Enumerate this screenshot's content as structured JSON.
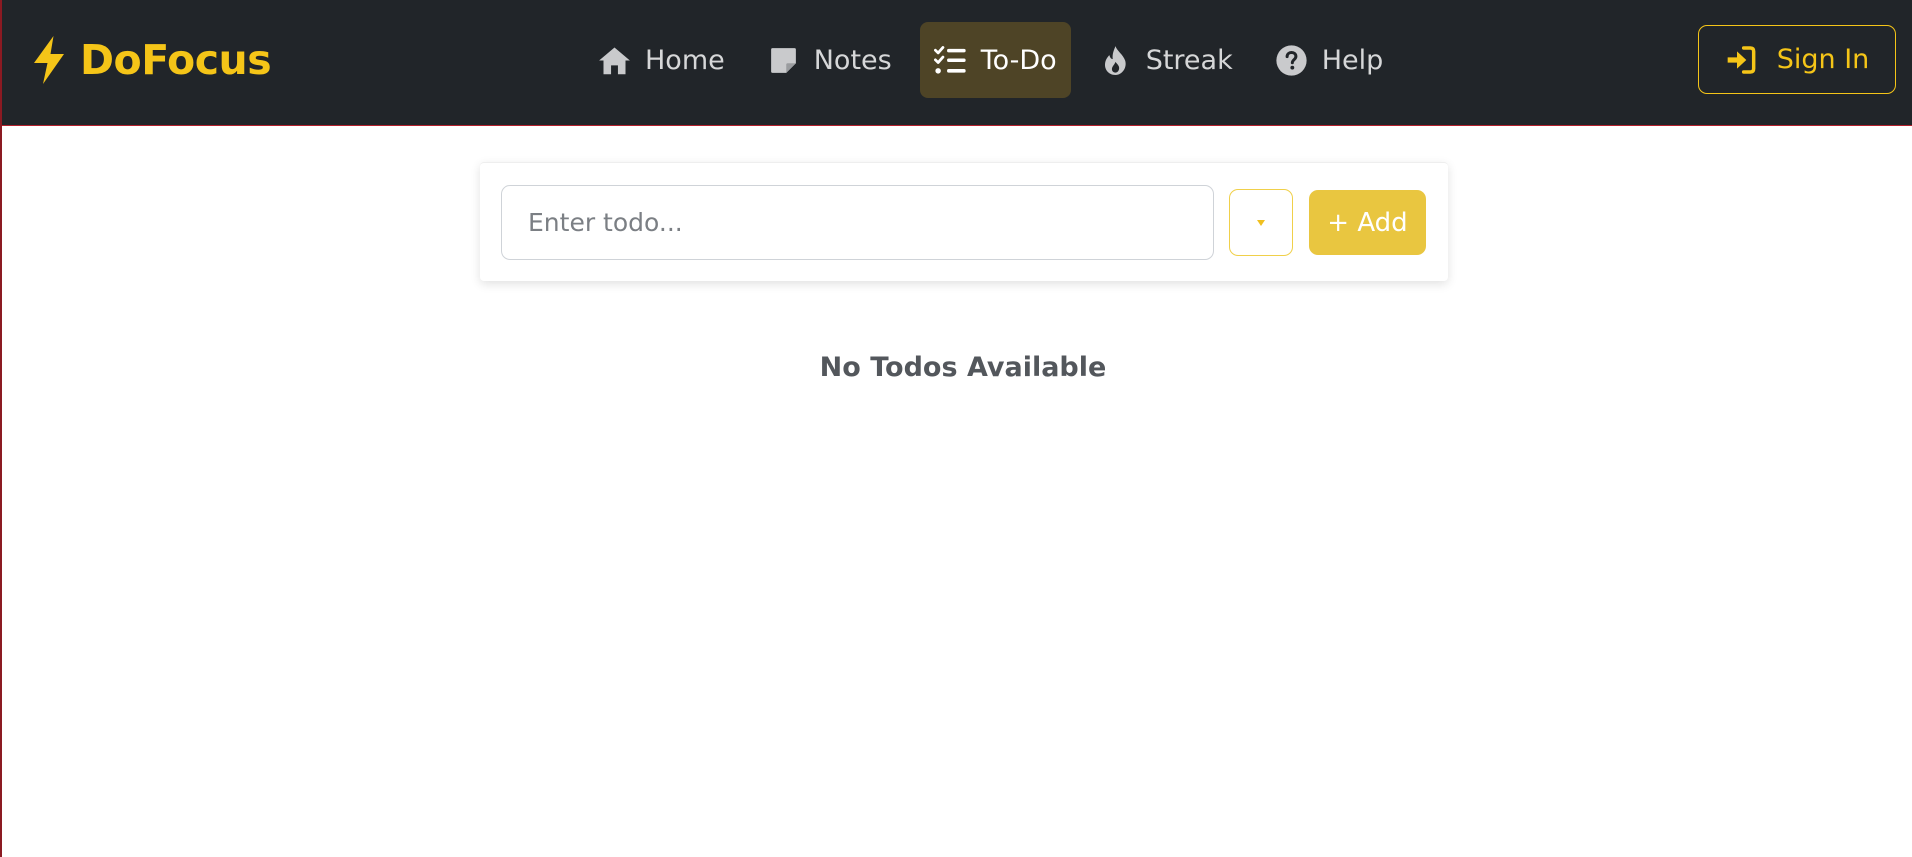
{
  "app": {
    "brand": "DoFocus",
    "brand_icon": "lightning-bolt-icon",
    "accent_color": "#f5c518"
  },
  "nav": {
    "items": [
      {
        "label": "Home",
        "icon": "home-icon",
        "active": false
      },
      {
        "label": "Notes",
        "icon": "note-icon",
        "active": false
      },
      {
        "label": "To-Do",
        "icon": "checklist-icon",
        "active": true
      },
      {
        "label": "Streak",
        "icon": "flame-icon",
        "active": false
      },
      {
        "label": "Help",
        "icon": "question-circle-icon",
        "active": false
      }
    ],
    "sign_in_label": "Sign In",
    "sign_in_icon": "sign-in-icon"
  },
  "todo": {
    "input_placeholder": "Enter todo...",
    "input_value": "",
    "dropdown_icon": "caret-down-icon",
    "add_label": "+ Add",
    "empty_message": "No Todos Available"
  }
}
